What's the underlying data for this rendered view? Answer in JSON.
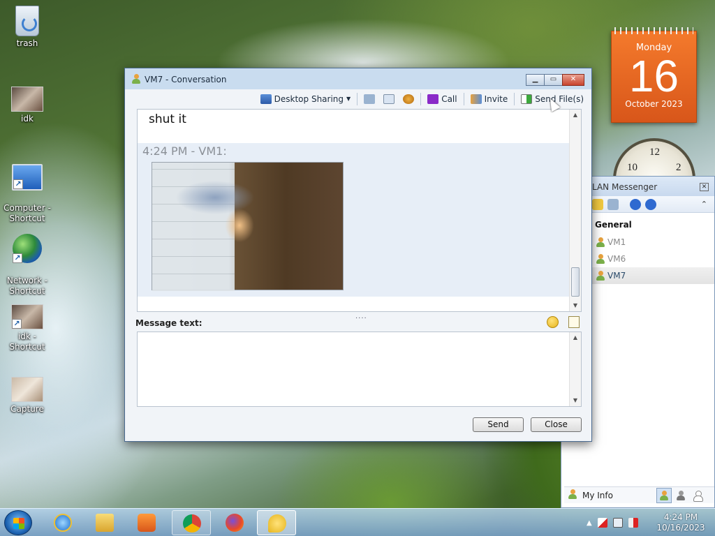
{
  "desktop": {
    "icons": [
      {
        "label": "trash",
        "icon": "recycle-bin-icon"
      },
      {
        "label": "idk",
        "icon": "image-thumbnail-icon"
      },
      {
        "label": "Computer -\nShortcut",
        "icon": "computer-icon"
      },
      {
        "label": "Network -\nShortcut",
        "icon": "network-icon"
      },
      {
        "label": "idk - Shortcut",
        "icon": "image-thumbnail-icon"
      },
      {
        "label": "Capture",
        "icon": "image-thumbnail-icon"
      }
    ]
  },
  "calendar_gadget": {
    "weekday": "Monday",
    "day": "16",
    "month_year": "October 2023"
  },
  "clock_gadget": {
    "numerals": [
      "10",
      "12",
      "2"
    ]
  },
  "conversation": {
    "title": "VM7 - Conversation",
    "toolbar": {
      "desktop_sharing": "Desktop Sharing",
      "call": "Call",
      "invite": "Invite",
      "send_files": "Send File(s)"
    },
    "history": {
      "previous_text": "shut it",
      "message_header": "4:24 PM - VM1:"
    },
    "message_label": "Message text:",
    "message_value": "",
    "send_label": "Send",
    "close_label": "Close",
    "splitter": "...."
  },
  "lan_messenger": {
    "title": "LAN Messenger",
    "group": "General",
    "contacts": [
      {
        "name": "VM1",
        "status": "offline"
      },
      {
        "name": "VM6",
        "status": "offline"
      },
      {
        "name": "VM7",
        "status": "online"
      }
    ],
    "my_info": "My Info"
  },
  "taskbar": {
    "time": "4:24 PM",
    "date": "10/16/2023",
    "apps": [
      "internet-explorer",
      "file-explorer",
      "media-player",
      "chrome",
      "firefox",
      "lan-messenger"
    ]
  }
}
